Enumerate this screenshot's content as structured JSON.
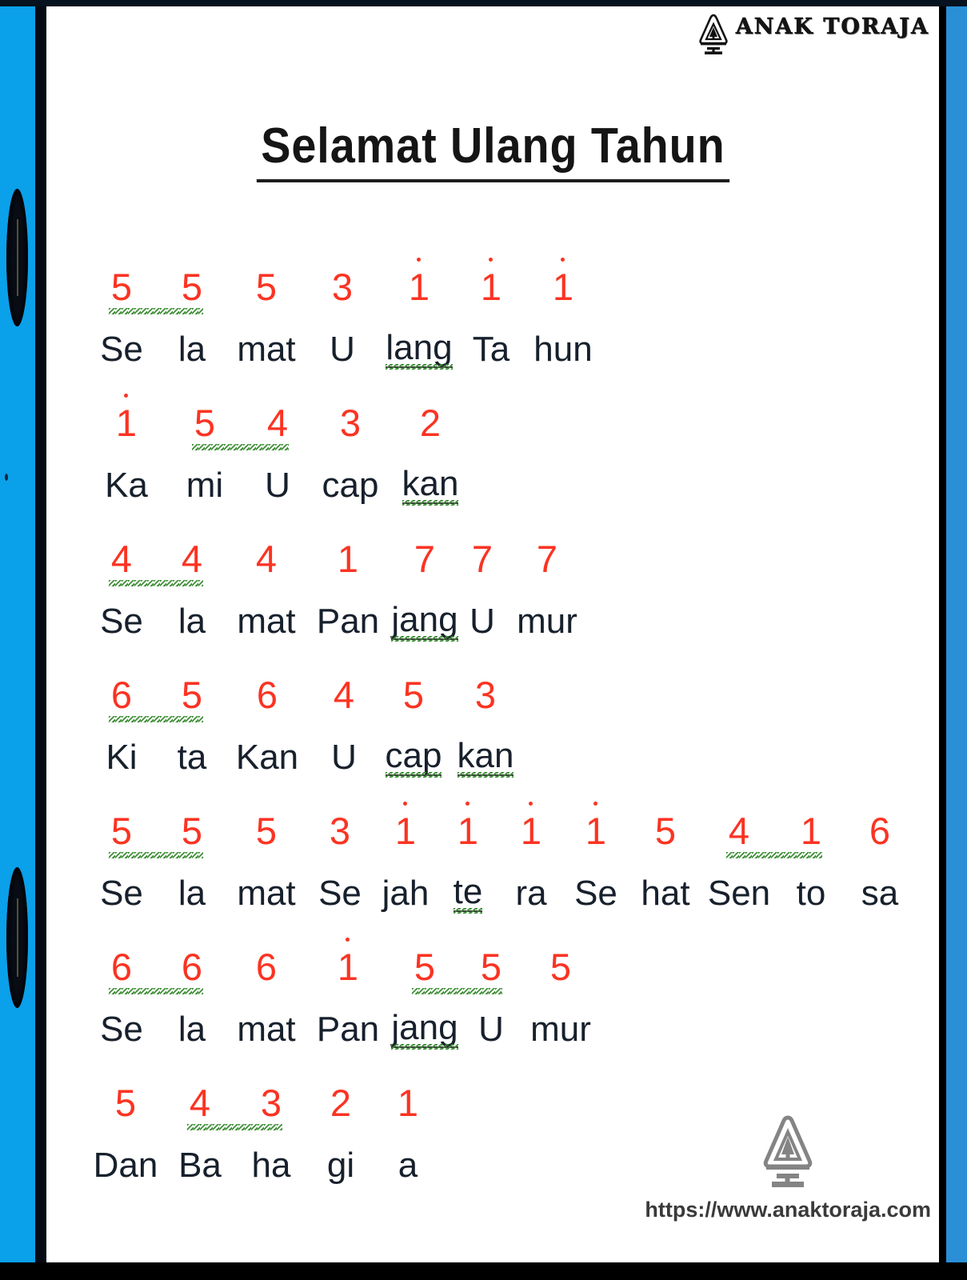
{
  "document": {
    "title": "Selamat Ulang Tahun",
    "type": "not-angka-sheet"
  },
  "header": {
    "brand_text": "ANAK TORAJA",
    "brand_icon": "tongkonan-a-logo"
  },
  "footer": {
    "watermark_icon": "anak-toraja-watermark",
    "url": "https://www.anaktoraja.com"
  },
  "colors": {
    "note_red": "#fb3322",
    "lyric_dark": "#17202c",
    "squiggle_green": "#3f8f37",
    "spine_blue": "#0aa0ea",
    "frame_black": "#000000"
  },
  "stanzas": [
    {
      "id": "line-1",
      "notes": [
        {
          "value": "5",
          "octave": "mid",
          "beam_start": true
        },
        {
          "value": "5",
          "octave": "mid",
          "beam_end": true
        },
        {
          "value": "5",
          "octave": "mid"
        },
        {
          "value": "3",
          "octave": "mid"
        },
        {
          "value": "1",
          "octave": "high"
        },
        {
          "value": "1",
          "octave": "high"
        },
        {
          "value": "1",
          "octave": "high"
        }
      ],
      "lyrics": [
        {
          "text": "Se"
        },
        {
          "text": "la"
        },
        {
          "text": "mat"
        },
        {
          "text": "U"
        },
        {
          "text": "lang",
          "squiggle": true
        },
        {
          "text": "Ta"
        },
        {
          "text": "hun"
        }
      ]
    },
    {
      "id": "line-2",
      "notes": [
        {
          "value": "1",
          "octave": "high"
        },
        {
          "value": "5",
          "octave": "mid",
          "beam_start": true
        },
        {
          "value": "4",
          "octave": "mid",
          "beam_end": true
        },
        {
          "value": "3",
          "octave": "mid"
        },
        {
          "value": "2",
          "octave": "mid"
        }
      ],
      "lyrics": [
        {
          "text": "Ka"
        },
        {
          "text": "mi"
        },
        {
          "text": "U"
        },
        {
          "text": "cap"
        },
        {
          "text": "kan",
          "squiggle": true
        }
      ]
    },
    {
      "id": "line-3",
      "notes": [
        {
          "value": "4",
          "octave": "mid",
          "beam_start": true
        },
        {
          "value": "4",
          "octave": "mid",
          "beam_end": true
        },
        {
          "value": "4",
          "octave": "mid"
        },
        {
          "value": "1",
          "octave": "mid"
        },
        {
          "value": "7",
          "octave": "low"
        },
        {
          "value": "7",
          "octave": "low"
        },
        {
          "value": "7",
          "octave": "low"
        }
      ],
      "lyrics": [
        {
          "text": "Se"
        },
        {
          "text": "la"
        },
        {
          "text": "mat"
        },
        {
          "text": "Pan"
        },
        {
          "text": "jang",
          "squiggle": true
        },
        {
          "text": "U"
        },
        {
          "text": "mur"
        }
      ]
    },
    {
      "id": "line-4",
      "notes": [
        {
          "value": "6",
          "octave": "mid",
          "beam_start": true
        },
        {
          "value": "5",
          "octave": "mid",
          "beam_end": true
        },
        {
          "value": "6",
          "octave": "mid"
        },
        {
          "value": "4",
          "octave": "mid"
        },
        {
          "value": "5",
          "octave": "mid"
        },
        {
          "value": "3",
          "octave": "mid"
        }
      ],
      "lyrics": [
        {
          "text": "Ki"
        },
        {
          "text": "ta"
        },
        {
          "text": "Kan"
        },
        {
          "text": "U"
        },
        {
          "text": "cap",
          "squiggle": true
        },
        {
          "text": "kan",
          "squiggle": true
        }
      ]
    },
    {
      "id": "line-5",
      "notes": [
        {
          "value": "5",
          "octave": "mid",
          "beam_start": true
        },
        {
          "value": "5",
          "octave": "mid",
          "beam_end": true
        },
        {
          "value": "5",
          "octave": "mid"
        },
        {
          "value": "3",
          "octave": "mid"
        },
        {
          "value": "1",
          "octave": "high"
        },
        {
          "value": "1",
          "octave": "high"
        },
        {
          "value": "1",
          "octave": "high"
        },
        {
          "value": "1",
          "octave": "high"
        },
        {
          "value": "5",
          "octave": "mid"
        },
        {
          "value": "4",
          "octave": "mid",
          "beam_start": true
        },
        {
          "value": "1",
          "octave": "mid",
          "beam_end": true
        },
        {
          "value": "6",
          "octave": "mid"
        }
      ],
      "lyrics": [
        {
          "text": "Se"
        },
        {
          "text": "la"
        },
        {
          "text": "mat"
        },
        {
          "text": "Se"
        },
        {
          "text": "jah"
        },
        {
          "text": "te",
          "squiggle": true
        },
        {
          "text": "ra"
        },
        {
          "text": "Se"
        },
        {
          "text": "hat"
        },
        {
          "text": "Sen"
        },
        {
          "text": "to"
        },
        {
          "text": "sa"
        }
      ]
    },
    {
      "id": "line-6",
      "notes": [
        {
          "value": "6",
          "octave": "mid",
          "beam_start": true
        },
        {
          "value": "6",
          "octave": "mid",
          "beam_end": true
        },
        {
          "value": "6",
          "octave": "mid"
        },
        {
          "value": "1",
          "octave": "high"
        },
        {
          "value": "5",
          "octave": "mid",
          "beam_start": true
        },
        {
          "value": "5",
          "octave": "mid",
          "beam_end": true
        },
        {
          "value": "5",
          "octave": "mid"
        }
      ],
      "lyrics": [
        {
          "text": "Se"
        },
        {
          "text": "la"
        },
        {
          "text": "mat"
        },
        {
          "text": "Pan"
        },
        {
          "text": "jang",
          "squiggle": true
        },
        {
          "text": "U"
        },
        {
          "text": "mur"
        }
      ]
    },
    {
      "id": "line-7",
      "notes": [
        {
          "value": "5",
          "octave": "mid"
        },
        {
          "value": "4",
          "octave": "mid",
          "beam_start": true
        },
        {
          "value": "3",
          "octave": "mid",
          "beam_end": true
        },
        {
          "value": "2",
          "octave": "mid"
        },
        {
          "value": "1",
          "octave": "mid"
        }
      ],
      "lyrics": [
        {
          "text": "Dan"
        },
        {
          "text": "Ba"
        },
        {
          "text": "ha"
        },
        {
          "text": "gi"
        },
        {
          "text": "a"
        }
      ]
    }
  ]
}
